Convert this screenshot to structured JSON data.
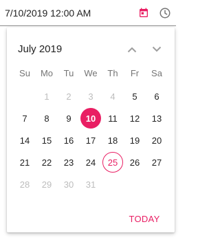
{
  "input": {
    "value": "7/10/2019 12:00 AM"
  },
  "popup": {
    "month_label": "July 2019",
    "weekdays": [
      "Su",
      "Mo",
      "Tu",
      "We",
      "Th",
      "Fr",
      "Sa"
    ],
    "days": [
      {
        "label": "",
        "state": "empty"
      },
      {
        "label": "1",
        "state": "disabled"
      },
      {
        "label": "2",
        "state": "disabled"
      },
      {
        "label": "3",
        "state": "disabled"
      },
      {
        "label": "4",
        "state": "disabled"
      },
      {
        "label": "5",
        "state": "normal"
      },
      {
        "label": "6",
        "state": "normal"
      },
      {
        "label": "7",
        "state": "normal"
      },
      {
        "label": "8",
        "state": "normal"
      },
      {
        "label": "9",
        "state": "normal"
      },
      {
        "label": "10",
        "state": "selected"
      },
      {
        "label": "11",
        "state": "normal"
      },
      {
        "label": "12",
        "state": "normal"
      },
      {
        "label": "13",
        "state": "normal"
      },
      {
        "label": "14",
        "state": "normal"
      },
      {
        "label": "15",
        "state": "normal"
      },
      {
        "label": "16",
        "state": "normal"
      },
      {
        "label": "17",
        "state": "normal"
      },
      {
        "label": "18",
        "state": "normal"
      },
      {
        "label": "19",
        "state": "normal"
      },
      {
        "label": "20",
        "state": "normal"
      },
      {
        "label": "21",
        "state": "normal"
      },
      {
        "label": "22",
        "state": "normal"
      },
      {
        "label": "23",
        "state": "normal"
      },
      {
        "label": "24",
        "state": "normal"
      },
      {
        "label": "25",
        "state": "today"
      },
      {
        "label": "26",
        "state": "normal"
      },
      {
        "label": "27",
        "state": "normal"
      },
      {
        "label": "28",
        "state": "disabled"
      },
      {
        "label": "29",
        "state": "disabled"
      },
      {
        "label": "30",
        "state": "disabled"
      },
      {
        "label": "31",
        "state": "disabled"
      }
    ],
    "today_button": "TODAY"
  },
  "icons": {
    "calendar": "calendar-icon",
    "clock": "clock-icon",
    "prev": "chevron-up-icon",
    "next": "chevron-down-icon"
  },
  "colors": {
    "accent": "#e91e63",
    "icon": "#757575",
    "disabled": "#bdbdbd"
  }
}
